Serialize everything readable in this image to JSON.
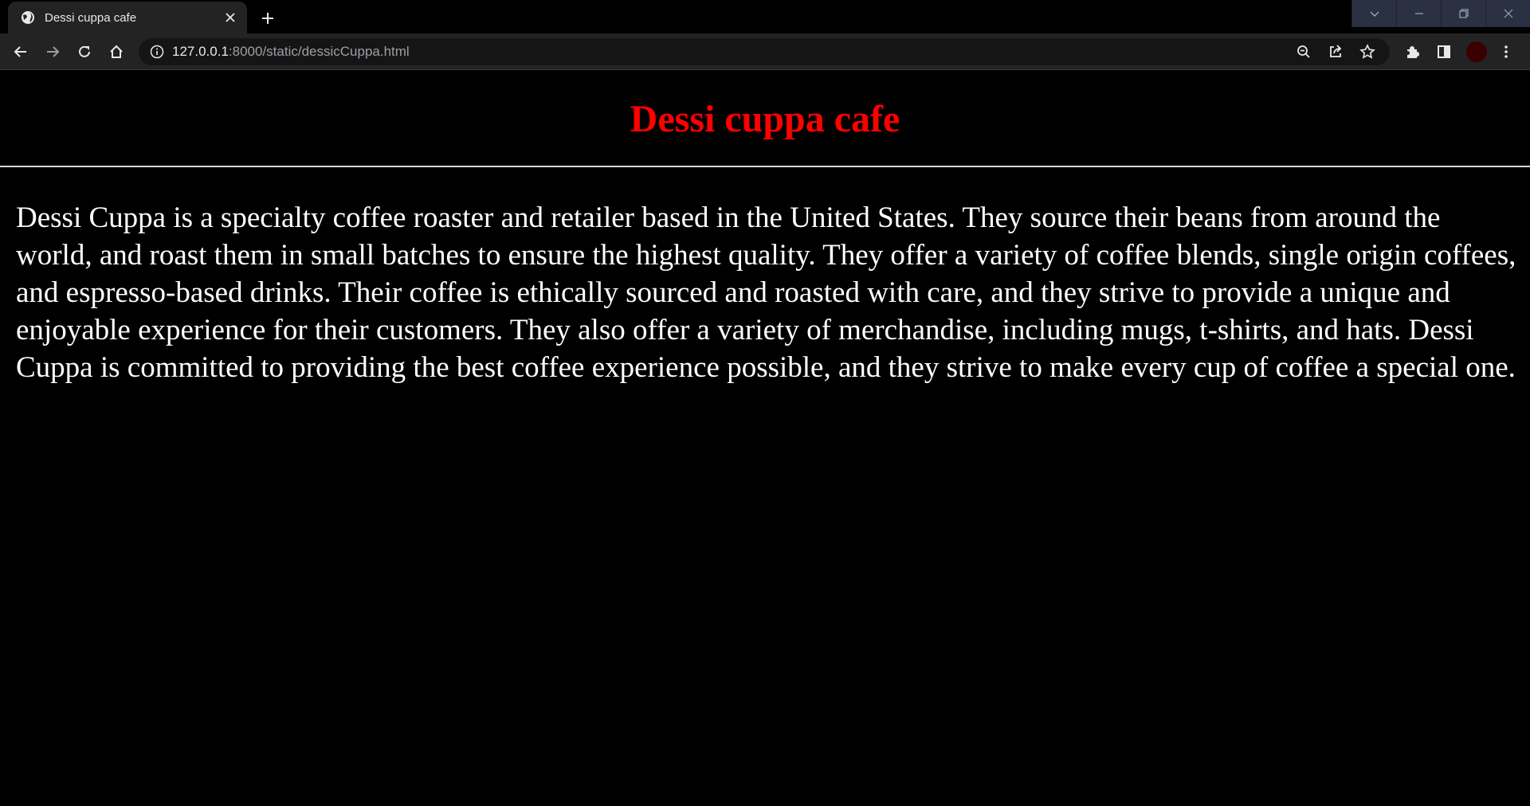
{
  "tab": {
    "title": "Dessi cuppa cafe"
  },
  "address_bar": {
    "url_host": "127.0.0.1",
    "url_path": ":8000/static/dessicCuppa.html"
  },
  "page": {
    "heading": "Dessi cuppa cafe",
    "paragraph": "Dessi Cuppa is a specialty coffee roaster and retailer based in the United States. They source their beans from around the world, and roast them in small batches to ensure the highest quality. They offer a variety of coffee blends, single origin coffees, and espresso-based drinks. Their coffee is ethically sourced and roasted with care, and they strive to provide a unique and enjoyable experience for their customers. They also offer a variety of merchandise, including mugs, t-shirts, and hats. Dessi Cuppa is committed to providing the best coffee experience possible, and they strive to make every cup of coffee a special one."
  },
  "colors": {
    "heading": "#ff0000",
    "text": "#ffffff",
    "background": "#000000",
    "toolbar": "#232323"
  },
  "icons": {
    "favicon": "globe-icon",
    "tab_close": "close-icon",
    "new_tab": "plus-icon",
    "back": "arrow-left-icon",
    "forward": "arrow-right-icon",
    "reload": "reload-icon",
    "home": "home-icon",
    "site_info": "info-icon",
    "zoom": "zoom-icon",
    "share": "share-icon",
    "bookmark": "star-icon",
    "extensions": "puzzle-icon",
    "side_panel": "side-panel-icon",
    "menu": "kebab-menu-icon"
  }
}
